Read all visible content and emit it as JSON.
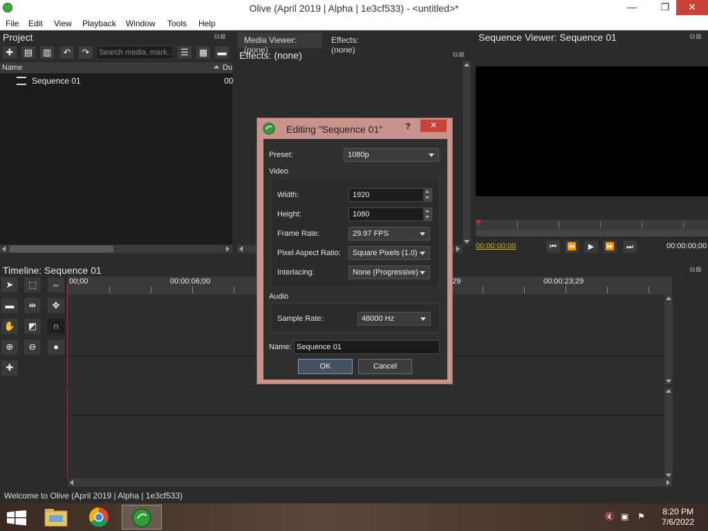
{
  "window": {
    "title": "Olive (April 2019 | Alpha | 1e3cf533) - <untitled>*",
    "minimize": "—",
    "restore": "❐",
    "close": "✕"
  },
  "menu": [
    "File",
    "Edit",
    "View",
    "Playback",
    "Window",
    "Tools",
    "Help"
  ],
  "project": {
    "title": "Project",
    "search_placeholder": "Search media, mark...",
    "col_name": "Name",
    "col_duration": "Du",
    "items": [
      {
        "name": "Sequence 01",
        "duration": "00"
      }
    ]
  },
  "center": {
    "tabs": [
      "Media Viewer: (none)",
      "Effects: (none)"
    ],
    "effects_title": "Effects: (none)"
  },
  "viewer": {
    "title": "Sequence Viewer: Sequence 01",
    "timecode_current": "00:00:00;00",
    "timecode_end": "00:00:00;00"
  },
  "timeline": {
    "title": "Timeline: Sequence 01",
    "ruler_labels": [
      "00;00",
      "00:00:06;00",
      "29",
      "00:00:23;29"
    ]
  },
  "dialog": {
    "title": "Editing \"Sequence 01\"",
    "help": "?",
    "preset_label": "Preset:",
    "preset_value": "1080p",
    "video_section": "Video",
    "width_label": "Width:",
    "width_value": "1920",
    "height_label": "Height:",
    "height_value": "1080",
    "framerate_label": "Frame Rate:",
    "framerate_value": "29.97 FPS",
    "par_label": "Pixel Aspect Ratio:",
    "par_value": "Square Pixels (1.0)",
    "interlacing_label": "Interlacing:",
    "interlacing_value": "None (Progressive)",
    "audio_section": "Audio",
    "samplerate_label": "Sample Rate:",
    "samplerate_value": "48000 Hz",
    "name_label": "Name:",
    "name_value": "Sequence 01",
    "ok": "OK",
    "cancel": "Cancel"
  },
  "status": {
    "text": "Welcome to Olive (April 2019 | Alpha | 1e3cf533)"
  },
  "taskbar": {
    "time": "8:20 PM",
    "date": "7/6/2022"
  },
  "colors": {
    "accent": "#3aa83a",
    "playhead": "#d02020",
    "dialog_frame": "#c7938a",
    "timecode": "#e0b000"
  }
}
